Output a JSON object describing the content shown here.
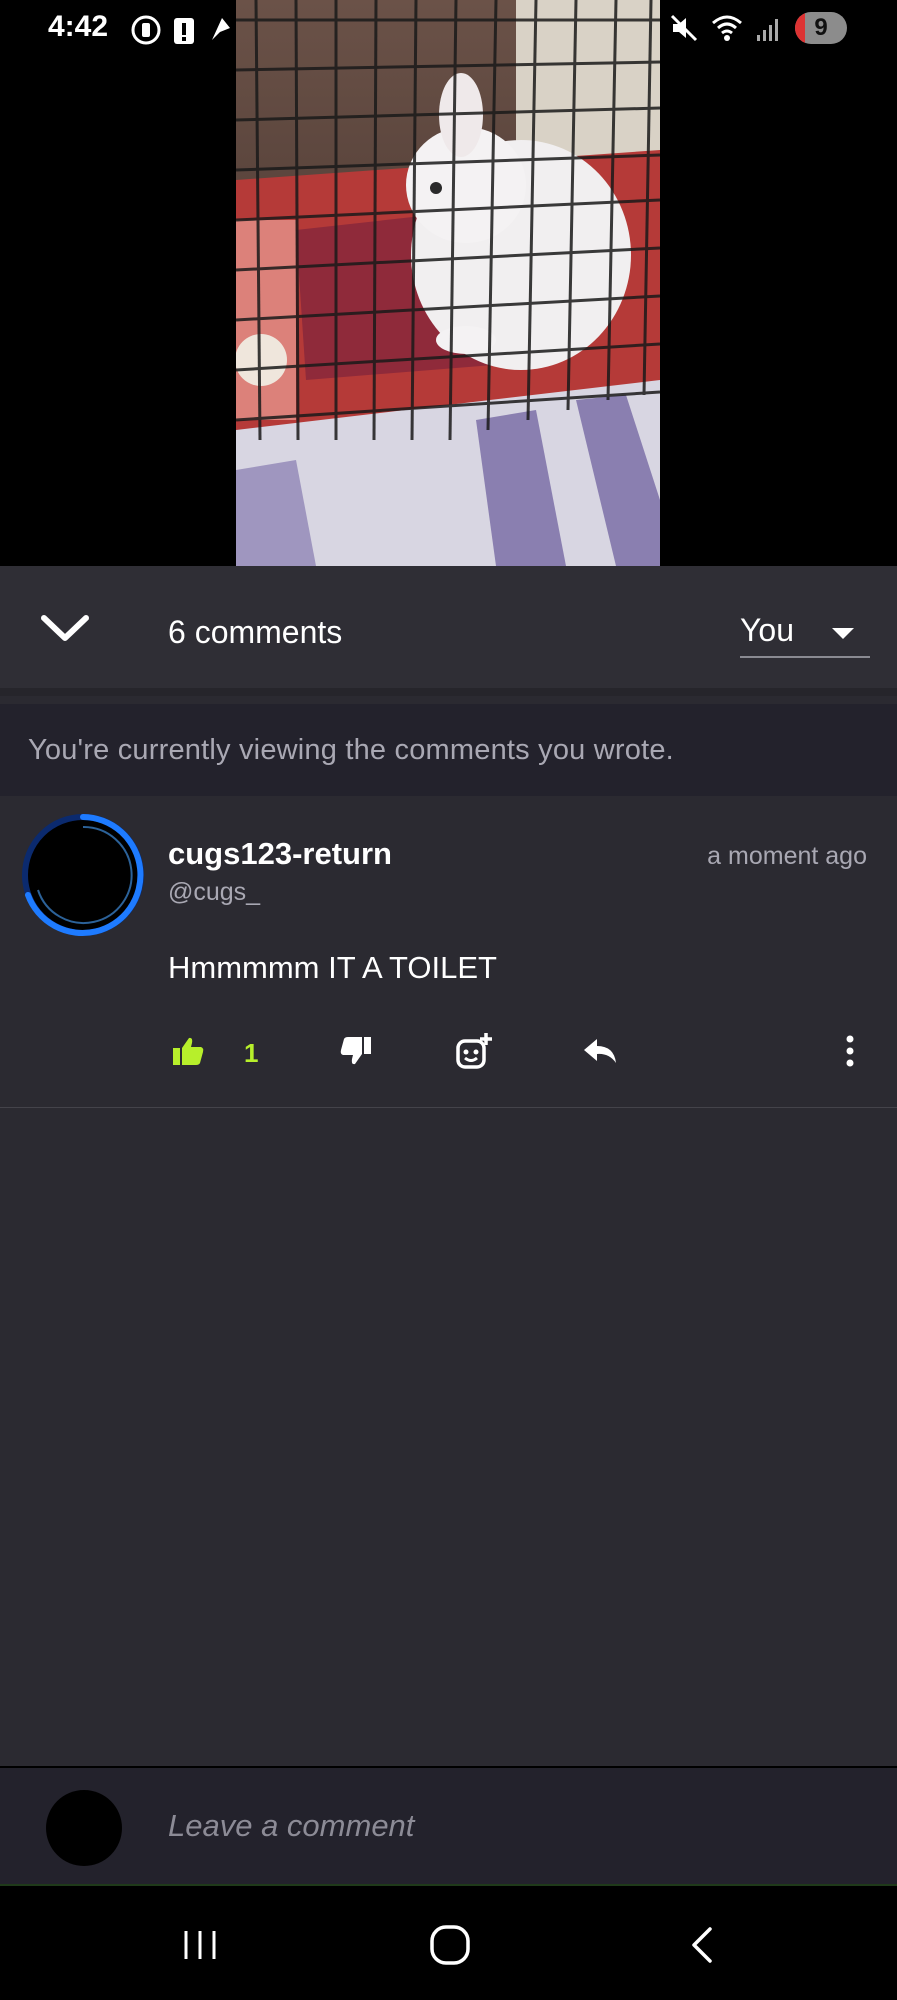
{
  "status_bar": {
    "time": "4:42",
    "notification_count": "9"
  },
  "comments_header": {
    "count_label": "6 comments",
    "sort_selected": "You"
  },
  "filter_notice": "You're currently viewing the comments you wrote.",
  "comment": {
    "author": "cugs123-return",
    "handle": "@cugs_",
    "timestamp": "a moment ago",
    "text": "Hmmmmm IT A TOILET",
    "like_count": "1"
  },
  "input": {
    "placeholder": "Leave a comment"
  },
  "colors": {
    "accent_like": "#b7ef2b",
    "avatar_ring": "#1e7bff",
    "panel_bg": "#2b2a31"
  },
  "icons": [
    "chevron-down-icon",
    "thumbs-up-icon",
    "thumbs-down-icon",
    "add-sticker-icon",
    "reply-icon",
    "more-vertical-icon",
    "recents-icon",
    "home-icon",
    "back-icon"
  ]
}
